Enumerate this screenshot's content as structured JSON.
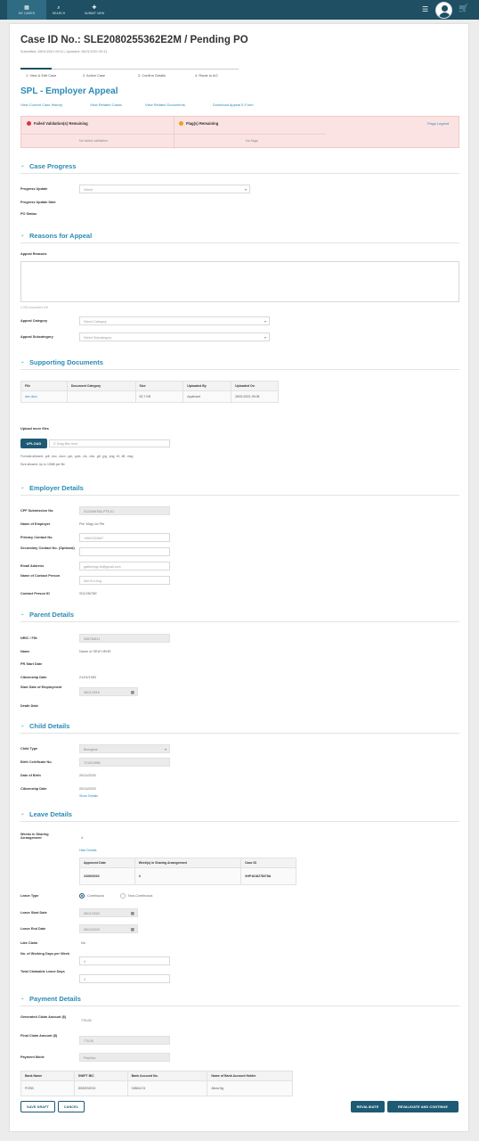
{
  "topnav": {
    "items": [
      {
        "label": "MY CASES",
        "icon": "cases-icon"
      },
      {
        "label": "SEARCH",
        "icon": "search-icon"
      },
      {
        "label": "SUBMIT NEW",
        "icon": "submit-icon"
      }
    ]
  },
  "case": {
    "title": "Case ID No.: SLE2080255362E2M / Pending PO",
    "submitted": "Submitted: 28/01/2021 09:11 | Updated: 28/01/2021 09:11"
  },
  "steps": [
    "1. View & Edit Case",
    "2. Action Case",
    "3. Confirm Details",
    "4. Route to AO"
  ],
  "appeal": {
    "title": "SPL - Employer Appeal",
    "links": [
      "View Current Case History",
      "View Related Cases",
      "View Related Documents",
      "Download Appeal E-Form"
    ]
  },
  "alert": {
    "left_title": "Failed Validation(s) Remaining",
    "right_title": "Flag(s) Remaining",
    "left_value": "No failed validation",
    "right_value": "No flags",
    "legend": "Flags Legend"
  },
  "sections": {
    "progress": "Case Progress",
    "reasons": "Reasons for Appeal",
    "documents": "Supporting Documents",
    "employer": "Employer Details",
    "parent": "Parent Details",
    "child": "Child Details",
    "leave": "Leave Details",
    "payment": "Payment Details"
  },
  "progress": {
    "update_label": "Progress Update",
    "update_placeholder": "Select",
    "date_label": "Progress Update Date",
    "status_label": "PO Status"
  },
  "reasons": {
    "reasons_label": "Appeal Reasons",
    "chars_left": "2,000 characters left",
    "category_label": "Appeal Category",
    "category_placeholder": "Select Category",
    "subcategory_label": "Appeal Subcategory",
    "subcategory_placeholder": "Select Subcategory"
  },
  "documents": {
    "headers": [
      "File",
      "Document Category",
      "Size",
      "Uploaded By",
      "Uploaded On"
    ],
    "rows": [
      [
        "abc.docx",
        "",
        "52.7 KB",
        "Applicant",
        "28/01/2021 09:08"
      ]
    ],
    "upload_label": "Upload more files",
    "upload_button": "UPLOAD",
    "dropzone": "Drag files here",
    "formats": "Formats allowed: .pdf, .doc, .docx, .ppt, .pptx, .xls, .xlsx, .gif, .jpg, .png, .tif, .tiff, .msg",
    "size": "Size allowed: Up to 10MB per file"
  },
  "employer": {
    "fields": [
      {
        "label": "CPF Submission No.",
        "value": "S12345678A-PTE-01"
      },
      {
        "label": "Name of Employer",
        "value": "Pte. Mag Ltd Pte"
      },
      {
        "label": "Primary Contact No.",
        "value": "+6591234567"
      },
      {
        "label": "Secondary Contact No. (Optional)",
        "value": ""
      },
      {
        "label": "Email Address",
        "value": "gatherings.ltd@gmail.com"
      },
      {
        "label": "Name of Contact Person",
        "value": "Wei Ern Ang"
      },
      {
        "label": "Contact Person ID",
        "value": "S0123678E"
      }
    ]
  },
  "parent": {
    "fields": [
      {
        "label": "NRIC / FIN",
        "value": "S9873661J"
      },
      {
        "label": "Name",
        "value": "Name of SEW HEHE"
      },
      {
        "label": "PR Start Date",
        "value": ""
      },
      {
        "label": "Citizenship Date",
        "value": "21/04/1983"
      },
      {
        "label": "Start Date of Employment",
        "value": "08/11/2016"
      },
      {
        "label": "Death Date",
        "value": ""
      }
    ]
  },
  "child": {
    "fields": [
      {
        "label": "Child Type",
        "value": "Biological"
      },
      {
        "label": "Birth Certificate No.",
        "value": "T2120199B"
      },
      {
        "label": "Date of Birth",
        "value": "20/11/2020"
      },
      {
        "label": "Citizenship Date",
        "value": "20/11/2020"
      }
    ],
    "show_details": "Show Details"
  },
  "leave": {
    "sharing_label": "Weeks in Sharing Arrangement",
    "sharing_value": "4",
    "hide_details": "Hide Details",
    "sharing_headers": [
      "Approved Date",
      "Week(s) in Sharing Arrangement",
      "Case ID"
    ],
    "sharing_rows": [
      [
        "23/09/2020",
        "4",
        "SHP1618278078A"
      ]
    ],
    "type_label": "Leave Type",
    "type_options": [
      "Continuous",
      "Non-Continuous"
    ],
    "start_label": "Leave Start Date",
    "start_value": "08/11/2020",
    "end_label": "Leave End Date",
    "end_value": "08/12/2020",
    "late_label": "Late Claim",
    "late_value": "No",
    "working_label": "No. of Working Days per Week",
    "working_value": "5",
    "claimable_label": "Total Claimable Leave Days",
    "claimable_value": "5"
  },
  "payment": {
    "generated_label": "Generated Claim Amount ($)",
    "generated_value": "770.00",
    "final_label": "Final Claim Amount ($)",
    "final_value": "770.00",
    "mode_label": "Payment Mode",
    "mode_value": "PayNow",
    "headers": [
      "Bank Name",
      "SWIFT BIC",
      "Bank Account No.",
      "Name of Bank Account Holder"
    ],
    "rows": [
      [
        "POSB",
        "DBSSSGSG",
        "02861474",
        "Alicia Ng"
      ]
    ]
  },
  "actions": {
    "save_draft": "SAVE DRAFT",
    "cancel": "CANCEL",
    "revalidate": "REVALIDATE",
    "revalidate_continue": "REVALIDATE AND CONTINUE"
  }
}
